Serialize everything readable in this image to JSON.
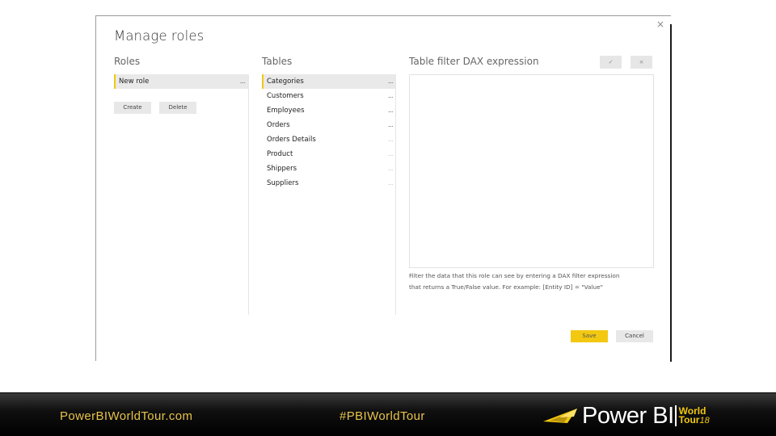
{
  "dialog": {
    "title": "Manage roles",
    "close_icon": "×",
    "roles": {
      "heading": "Roles",
      "items": [
        {
          "label": "New role",
          "more": "...",
          "selected": true
        }
      ],
      "create_label": "Create",
      "delete_label": "Delete"
    },
    "tables": {
      "heading": "Tables",
      "items": [
        {
          "label": "Categories",
          "more": "...",
          "selected": true
        },
        {
          "label": "Customers",
          "more": "..."
        },
        {
          "label": "Employees",
          "more": "..."
        },
        {
          "label": "Orders",
          "more": "..."
        },
        {
          "label": "Orders Details",
          "more": "..."
        },
        {
          "label": "Product",
          "more": "..."
        },
        {
          "label": "Shippers",
          "more": "..."
        },
        {
          "label": "Suppliers",
          "more": "..."
        }
      ]
    },
    "dax": {
      "heading": "Table filter DAX expression",
      "accept_icon": "✓",
      "cancel_icon": "×",
      "value": "",
      "hint_line1": "Filter the data that this role can see by entering a DAX filter expression",
      "hint_line2": "that returns a True/False value. For example: [Entity ID] = \"Value\""
    },
    "save_label": "Save",
    "cancel_label": "Cancel",
    "accent_color": "#f2c811"
  },
  "footer": {
    "url": "PowerBIWorldTour.com",
    "hashtag": "#PBIWorldTour",
    "logo_text": "Power BI",
    "logo_world": "World",
    "logo_tour": "Tour",
    "logo_year": "18",
    "text_color": "#e8c34a"
  }
}
